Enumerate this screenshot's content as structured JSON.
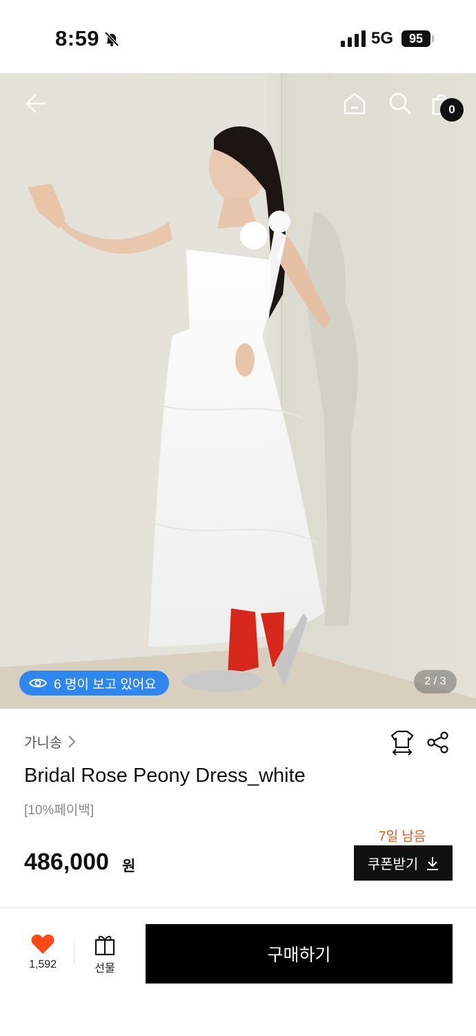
{
  "status_bar": {
    "time": "8:59",
    "network": "5G",
    "battery": "95"
  },
  "hero": {
    "viewers_text": "6 명이 보고 있어요",
    "image_counter": "2 / 3",
    "cart_count": "0"
  },
  "product": {
    "brand": "가니송",
    "title": "Bridal Rose Peony Dress_white",
    "tag": "[10%페이백]",
    "days_left": "7일 남음",
    "price": "486,000",
    "price_unit": "원",
    "coupon_label": "쿠폰받기"
  },
  "bottom_bar": {
    "like_count": "1,592",
    "gift_label": "선물",
    "buy_label": "구매하기"
  },
  "colors": {
    "accent_blue": "#2e86ee",
    "heart_orange": "#ff4a17",
    "days_left_orange": "#d85a1e",
    "button_black": "#000000"
  },
  "icons": [
    "bell-slash-icon",
    "signal-icon",
    "back-arrow-icon",
    "home-icon",
    "search-icon",
    "bag-icon",
    "eye-icon",
    "chevron-right-icon",
    "size-guide-icon",
    "share-icon",
    "download-icon",
    "heart-icon",
    "gift-icon"
  ]
}
